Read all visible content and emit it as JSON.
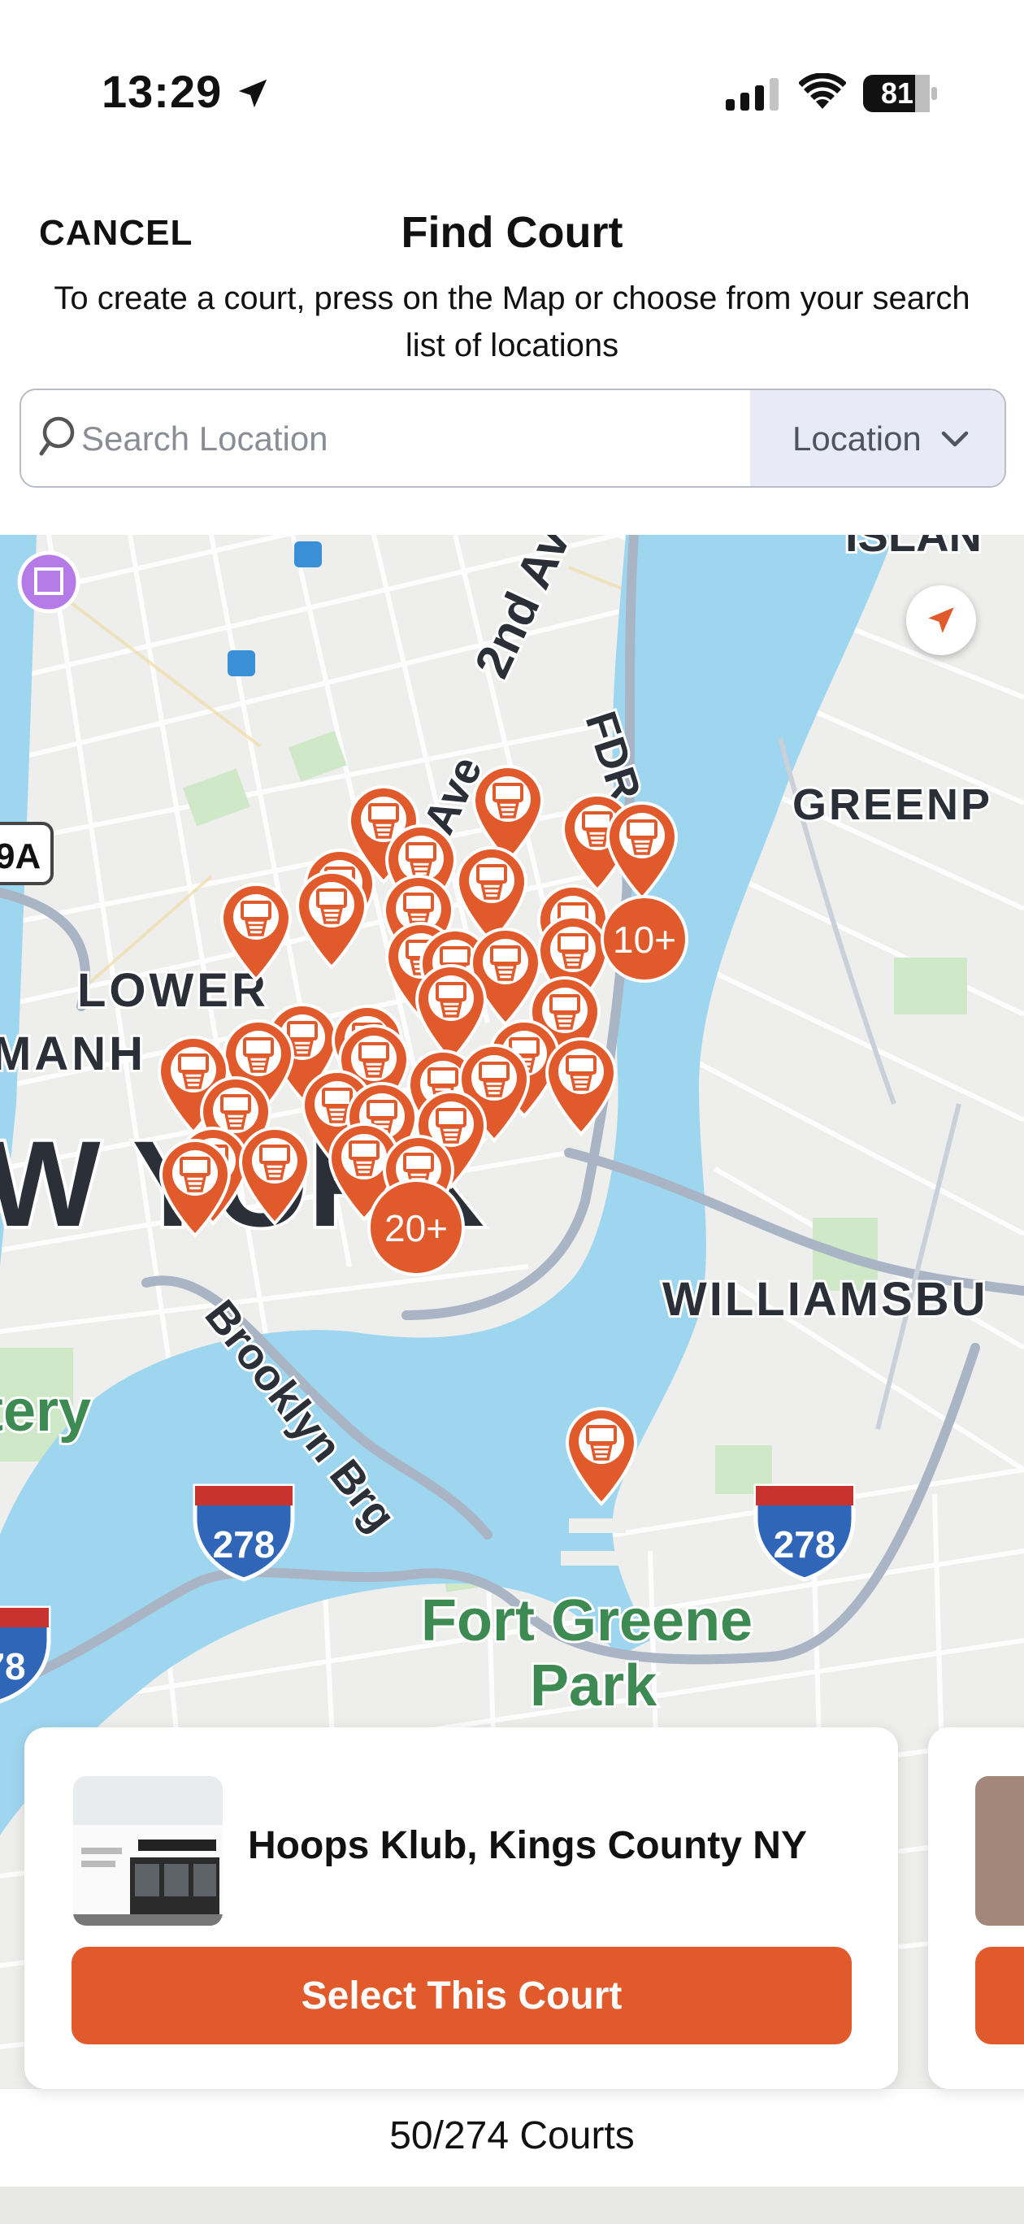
{
  "status_bar": {
    "time": "13:29",
    "battery": "81"
  },
  "header": {
    "cancel_label": "CANCEL",
    "title": "Find Court",
    "subtitle": "To create a court, press on the Map or choose from your search list of locations"
  },
  "search": {
    "placeholder": "Search Location",
    "value": ""
  },
  "location_filter": {
    "selected": "Location"
  },
  "map": {
    "labels": {
      "lower_manhattan_line1": "LOWER",
      "lower_manhattan_line2": "MANH",
      "new_york": "W YORK",
      "greenpoint": "GREENP",
      "island": "ISLAN",
      "williamsburg": "WILLIAMSBU",
      "ave_2nd": "2nd Av",
      "fdr": "FDR",
      "st_ave": "t Ave",
      "brooklyn_bridge": "Brooklyn Brg",
      "fort_greene_line1": "Fort Greene",
      "fort_greene_line2": "Park",
      "battery": "tery",
      "route_9a": "9A",
      "highway_278_a": "278",
      "highway_278_b": "278",
      "highway_78": "78"
    },
    "clusters": [
      "10+",
      "20+"
    ]
  },
  "court_card": {
    "name": "Hoops Klub, Kings County NY",
    "select_label": "Select This Court"
  },
  "court_count": "50/274 Courts",
  "colors": {
    "accent": "#e05a2c",
    "water": "#9fd6ef",
    "park": "#cfe8c8"
  }
}
